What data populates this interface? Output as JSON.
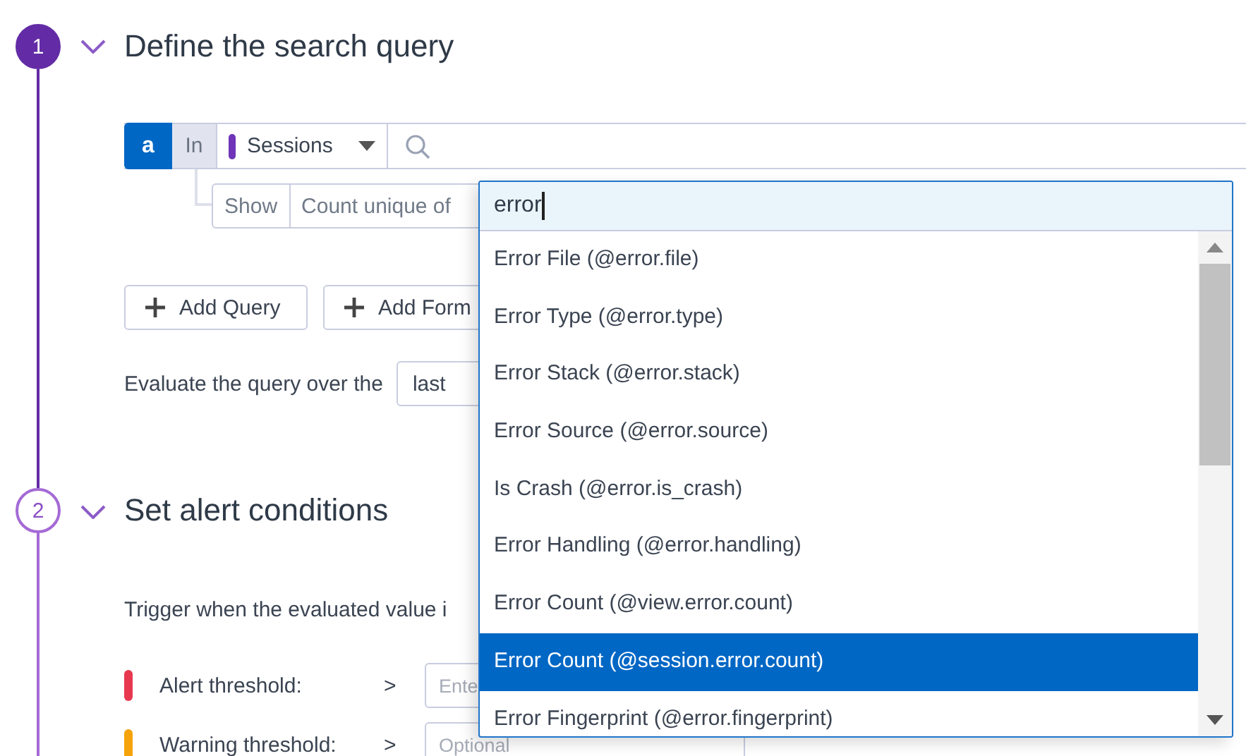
{
  "steps": [
    {
      "number": "1",
      "title": "Define the search query",
      "active": true,
      "expanded": true
    },
    {
      "number": "2",
      "title": "Set alert conditions",
      "active": false,
      "expanded": true
    }
  ],
  "query": {
    "name": "a",
    "in_label": "In",
    "data_source": "Sessions",
    "show_label": "Show",
    "aggregation": "Count unique of"
  },
  "buttons": [
    "Add Query",
    "Add Form"
  ],
  "evaluate": {
    "label": "Evaluate the query over the",
    "timeframe": "last"
  },
  "trigger_text": "Trigger when the evaluated value i",
  "thresholds": [
    {
      "label": "Alert threshold:",
      "operator": ">",
      "placeholder": "Ente",
      "color": "#e8384f"
    },
    {
      "label": "Warning threshold:",
      "operator": ">",
      "placeholder": "Optional",
      "color": "#f5a30a"
    }
  ],
  "attribute_dropdown": {
    "value": "error",
    "options": [
      {
        "label": "Error File (@error.file)",
        "selected": false
      },
      {
        "label": "Error Type (@error.type)",
        "selected": false
      },
      {
        "label": "Error Stack (@error.stack)",
        "selected": false
      },
      {
        "label": "Error Source (@error.source)",
        "selected": false
      },
      {
        "label": "Is Crash (@error.is_crash)",
        "selected": false
      },
      {
        "label": "Error Handling (@error.handling)",
        "selected": false
      },
      {
        "label": "Error Count (@view.error.count)",
        "selected": false
      },
      {
        "label": "Error Count (@session.error.count)",
        "selected": true
      },
      {
        "label": "Error Fingerprint (@error.fingerprint)",
        "selected": false
      }
    ]
  }
}
